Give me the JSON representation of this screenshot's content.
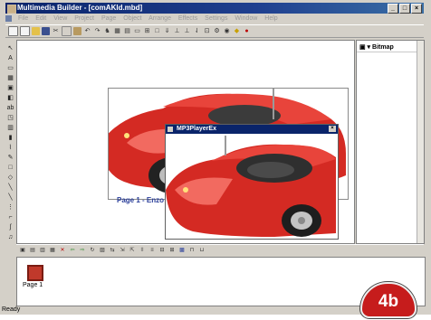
{
  "window": {
    "title": "Multimedia Builder - [comAKld.mbd]",
    "controls": [
      "_",
      "□",
      "×"
    ]
  },
  "menu": [
    "File",
    "Edit",
    "View",
    "Project",
    "Page",
    "Object",
    "Arrange",
    "Effects",
    "Settings",
    "Window",
    "Help"
  ],
  "toolbar_icons": [
    "new-icon",
    "new2-icon",
    "open-icon",
    "save-icon",
    "cut-icon",
    "copy-icon",
    "paste-icon",
    "undo-icon",
    "redo-icon",
    "run-icon",
    "grid-icon",
    "align-icon",
    "distribute-icon",
    "group-icon",
    "ungroup-icon",
    "lock-icon",
    "front-icon",
    "back-icon",
    "forward-icon",
    "backward-icon",
    "zoom-icon",
    "settings-icon",
    "audio-icon",
    "help-icon"
  ],
  "left_tools": [
    "pointer-icon",
    "text-icon",
    "button-icon",
    "bitmap-icon",
    "image-icon",
    "shape-icon",
    "line-icon",
    "rect-icon",
    "ellipse-icon",
    "polygon-icon",
    "star-icon",
    "pencil-icon",
    "fill-icon",
    "eraser-icon",
    "hand-icon",
    "zoom-tool-icon",
    "select-icon",
    "arrow-icon",
    "dots-icon",
    "audio-tool-icon"
  ],
  "canvas": {
    "caption": "Page 1 - Enzo"
  },
  "player": {
    "title": "MP3PlayerEx",
    "close": "×"
  },
  "right_panel": {
    "header": "Bitmap"
  },
  "bottom_toolbar_icons": [
    "layer-icon",
    "page-add-icon",
    "page-copy-icon",
    "page-delete-icon",
    "close-icon",
    "prev-icon",
    "next-icon",
    "import-icon",
    "export-icon",
    "flip-icon",
    "align-left-icon",
    "align-center-icon",
    "align-right-icon",
    "space-icon",
    "size-icon",
    "order-icon",
    "grid2-icon",
    "snap-icon",
    "ruler-icon"
  ],
  "pages": [
    {
      "label": "Page 1"
    }
  ],
  "status": "Ready",
  "badge": "4b",
  "colors": {
    "title_bar": "#0a246a",
    "car_red": "#d42a23",
    "badge": "#c61c1c"
  }
}
